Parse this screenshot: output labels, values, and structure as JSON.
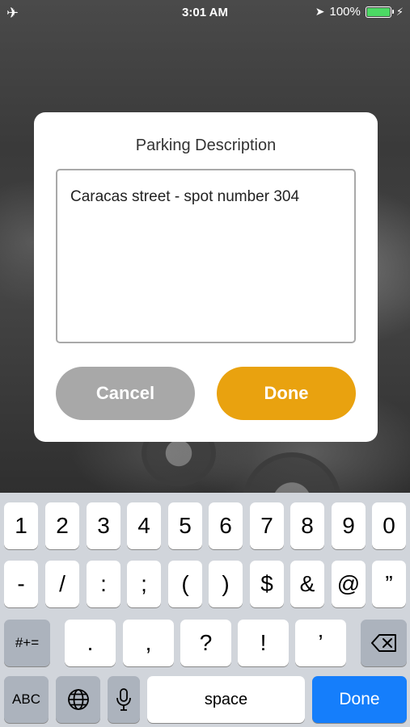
{
  "status_bar": {
    "time": "3:01 AM",
    "battery": "100%",
    "battery_color": "#4cd964"
  },
  "dialog": {
    "title": "Parking Description",
    "description_value": "Caracas street - spot number 304",
    "cancel_label": "Cancel",
    "done_label": "Done",
    "cancel_color": "#a8a8a8",
    "done_color": "#e9a20f"
  },
  "keyboard": {
    "row1": [
      "1",
      "2",
      "3",
      "4",
      "5",
      "6",
      "7",
      "8",
      "9",
      "0"
    ],
    "row2": [
      "-",
      "/",
      ":",
      ";",
      "(",
      ")",
      "$",
      "&",
      "@",
      "”"
    ],
    "row3": {
      "symbols_label": "#+=",
      "keys": [
        ".",
        ",",
        "?",
        "!",
        "’"
      ]
    },
    "row4": {
      "abc_label": "ABC",
      "space_label": "space",
      "done_label": "Done",
      "done_color": "#157efb"
    }
  }
}
